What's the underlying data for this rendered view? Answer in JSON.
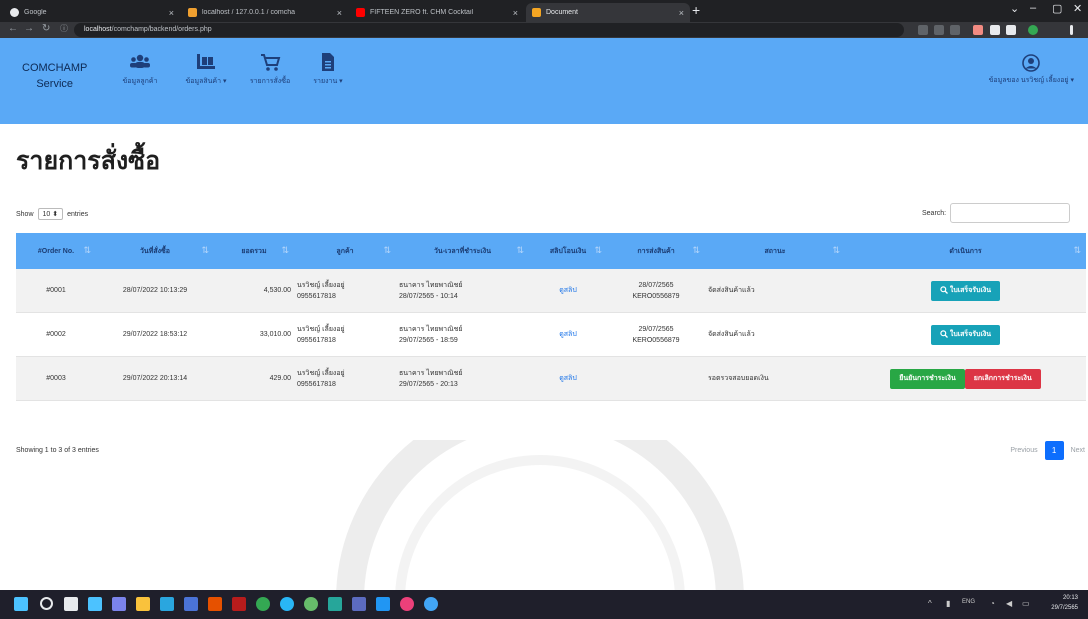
{
  "browser": {
    "tabs": [
      {
        "label": "Google"
      },
      {
        "label": "localhost / 127.0.0.1 / comcha"
      },
      {
        "label": "FIFTEEN ZERO ft. CHM Cocktail"
      },
      {
        "label": "Document"
      }
    ],
    "url_host": "localhost",
    "url_path": "/comchamp/backend/orders.php"
  },
  "navbar": {
    "brand_line1": "COMCHAMP",
    "brand_line2": "Service",
    "items": [
      {
        "label": "ข้อมูลลูกค้า",
        "icon": "users-icon"
      },
      {
        "label": "ข้อมูลสินค้า ▾",
        "icon": "boxes-icon"
      },
      {
        "label": "รายการสั่งซื้อ",
        "icon": "cart-icon"
      },
      {
        "label": "รายงาน ▾",
        "icon": "report-icon"
      }
    ],
    "user_label": "ข้อมูลของ นรวิชญ์ เลี้ยงอยู่ ▾"
  },
  "page": {
    "title": "รายการสั่งซื้อ"
  },
  "table_controls": {
    "show_label": "Show",
    "show_value": "10 ⬍",
    "entries_label": "entries",
    "search_label": "Search:"
  },
  "table": {
    "headers": [
      "#Order No.",
      "วันที่สั่งซื้อ",
      "ยอดรวม",
      "ลูกค้า",
      "วัน-เวลาที่ชำระเงิน",
      "สลิปโอนเงิน",
      "การส่งสินค้า",
      "สถานะ",
      "ดำเนินการ"
    ],
    "rows": [
      {
        "order_no": "#0001",
        "order_date": "28/07/2022 10:13:29",
        "total": "4,530.00",
        "customer_name": "นรวิชญ์ เลี้ยงอยู่",
        "customer_phone": "0955617818",
        "payment_bank": "ธนาคาร ไทยพาณิชย์",
        "payment_time": "28/07/2565 - 10:14",
        "slip": "ดูสลิป",
        "ship_date": "28/07/2565",
        "tracking": "KERO0556879",
        "status": "จัดส่งสินค้าแล้ว",
        "action": "ใบเสร็จรับเงิน"
      },
      {
        "order_no": "#0002",
        "order_date": "29/07/2022 18:53:12",
        "total": "33,010.00",
        "customer_name": "นรวิชญ์ เลี้ยงอยู่",
        "customer_phone": "0955617818",
        "payment_bank": "ธนาคาร ไทยพาณิชย์",
        "payment_time": "29/07/2565 - 18:59",
        "slip": "ดูสลิป",
        "ship_date": "29/07/2565",
        "tracking": "KERO0556879",
        "status": "จัดส่งสินค้าแล้ว",
        "action": "ใบเสร็จรับเงิน"
      },
      {
        "order_no": "#0003",
        "order_date": "29/07/2022 20:13:14",
        "total": "429.00",
        "customer_name": "นรวิชญ์ เลี้ยงอยู่",
        "customer_phone": "0955617818",
        "payment_bank": "ธนาคาร ไทยพาณิชย์",
        "payment_time": "29/07/2565 - 20:13",
        "slip": "ดูสลิป",
        "ship_date": "",
        "tracking": "",
        "status": "รอตรวจสอบยอดเงิน",
        "confirm_label": "ยืนยันการชำระเงิน",
        "cancel_label": "ยกเลิกการชำระเงิน"
      }
    ]
  },
  "footer": {
    "showing": "Showing 1 to 3 of 3 entries",
    "prev": "Previous",
    "page": "1",
    "next": "Next"
  },
  "taskbar": {
    "lang": "ENG",
    "time": "20:13",
    "date": "29/7/2565"
  },
  "colors": {
    "navbar": "#5aa9f6",
    "info": "#17a2b8",
    "success": "#28a745",
    "danger": "#dc3545",
    "link": "#1a73e8"
  }
}
